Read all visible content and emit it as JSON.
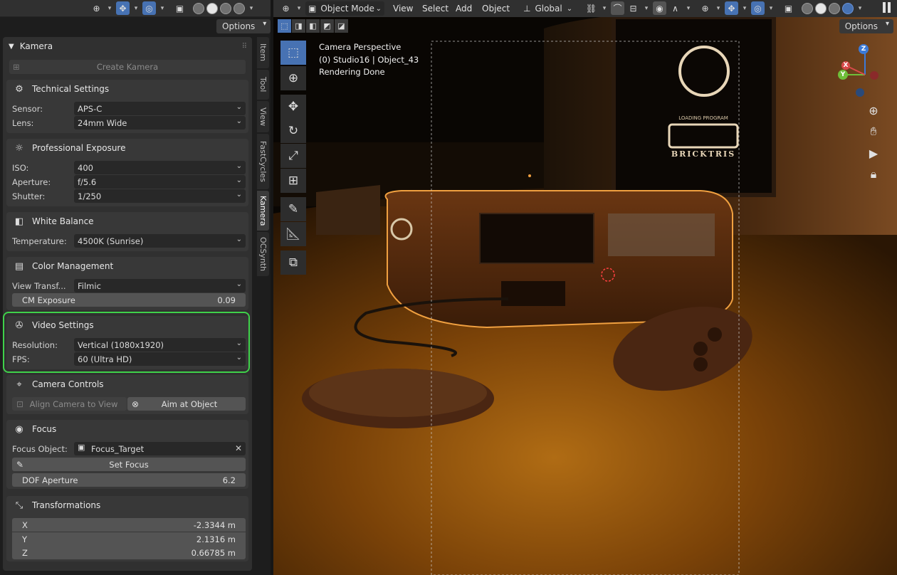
{
  "left_header": {
    "options_label": "Options"
  },
  "side_tabs": [
    "Item",
    "Tool",
    "View",
    "FastCycles",
    "Kamera",
    "OCSynth"
  ],
  "kamera": {
    "title": "Kamera",
    "create_button": "Create Kamera",
    "technical": {
      "title": "Technical Settings",
      "sensor_label": "Sensor:",
      "sensor_value": "APS-C",
      "lens_label": "Lens:",
      "lens_value": "24mm Wide"
    },
    "exposure": {
      "title": "Professional Exposure",
      "iso_label": "ISO:",
      "iso_value": "400",
      "aperture_label": "Aperture:",
      "aperture_value": "f/5.6",
      "shutter_label": "Shutter:",
      "shutter_value": "1/250"
    },
    "white_balance": {
      "title": "White Balance",
      "temperature_label": "Temperature:",
      "temperature_value": "4500K (Sunrise)"
    },
    "color_management": {
      "title": "Color Management",
      "view_transform_label": "View Transf...",
      "view_transform_value": "Filmic",
      "cm_exposure_label": "CM Exposure",
      "cm_exposure_value": "0.09"
    },
    "video": {
      "title": "Video Settings",
      "resolution_label": "Resolution:",
      "resolution_value": "Vertical (1080x1920)",
      "fps_label": "FPS:",
      "fps_value": "60 (Ultra HD)"
    },
    "camera_controls": {
      "title": "Camera Controls",
      "align_button": "Align Camera to View",
      "aim_button": "Aim at Object"
    },
    "focus": {
      "title": "Focus",
      "focus_object_label": "Focus Object:",
      "focus_object_value": "Focus_Target",
      "set_focus_button": "Set Focus",
      "dof_label": "DOF Aperture",
      "dof_value": "6.2"
    },
    "transformations": {
      "title": "Transformations",
      "x_label": "X",
      "x_value": "-2.3344 m",
      "y_label": "Y",
      "y_value": "2.1316 m",
      "z_label": "Z",
      "z_value": "0.66785 m"
    }
  },
  "viewport": {
    "mode": "Object Mode",
    "menus": [
      "View",
      "Select",
      "Add",
      "Object"
    ],
    "orientation": "Global",
    "options_label": "Options",
    "overlay": [
      "Camera Perspective",
      "(0) Studio16 | Object_43",
      "Rendering Done"
    ],
    "screen_text": {
      "line1": "LOADING PROGRAM",
      "line2": "BRICKTRIS"
    },
    "gizmo": {
      "x": "X",
      "y": "Y",
      "z": "Z"
    }
  },
  "colors": {
    "accent": "#4772b3",
    "highlight": "#3fd14a",
    "panel": "#303030",
    "subpanel": "#383838"
  }
}
